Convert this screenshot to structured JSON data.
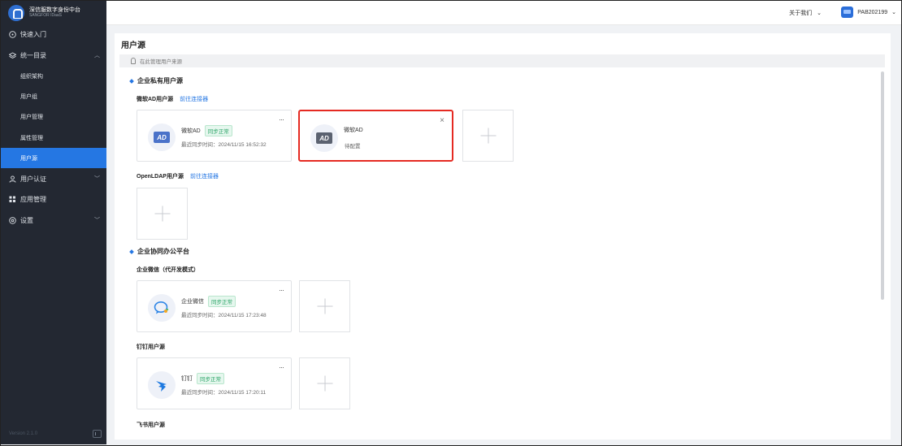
{
  "brand": {
    "title": "深信服数字身份中台",
    "subtitle": "SANGFOR IDaaS"
  },
  "sidebar": {
    "items": [
      {
        "label": "快速入门",
        "icon": "compass-icon"
      },
      {
        "label": "统一目录",
        "icon": "layers-icon",
        "expanded": true
      },
      {
        "label": "用户认证",
        "icon": "user-icon"
      },
      {
        "label": "应用管理",
        "icon": "grid-icon"
      },
      {
        "label": "设置",
        "icon": "gear-icon"
      }
    ],
    "subitems": [
      "组织架构",
      "用户组",
      "用户管理",
      "属性管理",
      "用户源"
    ],
    "active_subitem": "用户源",
    "version": "Version 2.1.0"
  },
  "topbar": {
    "about": "关于我们",
    "username": "PAB202199"
  },
  "page": {
    "title": "用户源",
    "hint": "在此管理用户来源",
    "sections": [
      {
        "title": "企业私有用户源"
      },
      {
        "title": "企业协同办公平台"
      }
    ],
    "groups": {
      "ad": {
        "label": "微软AD用户源",
        "link": "前往连接器"
      },
      "ldap": {
        "label": "OpenLDAP用户源",
        "link": "前往连接器"
      },
      "wework": {
        "label": "企业微信（代开发模式）"
      },
      "dingtalk": {
        "label": "钉钉用户源"
      },
      "feishu": {
        "label": "飞书用户源"
      }
    },
    "cards": {
      "ad_active": {
        "name": "微软AD",
        "badge": "同步正常",
        "time": "最近同步时间：2024/11/15 16:52:32",
        "more": "···"
      },
      "ad_pending": {
        "name": "微软AD",
        "status": "待配置",
        "close": "×"
      },
      "wework": {
        "name": "企业微信",
        "badge": "同步正常",
        "time": "最近同步时间：2024/11/15 17:23:48",
        "more": "···"
      },
      "dingtalk": {
        "name": "钉钉",
        "badge": "同步正常",
        "time": "最近同步时间：2024/11/15 17:20:11",
        "more": "···"
      }
    }
  },
  "colors": {
    "accent": "#2577e3",
    "sidebar_bg": "#232832",
    "success": "#2aa467",
    "highlight": "#e52a22"
  }
}
